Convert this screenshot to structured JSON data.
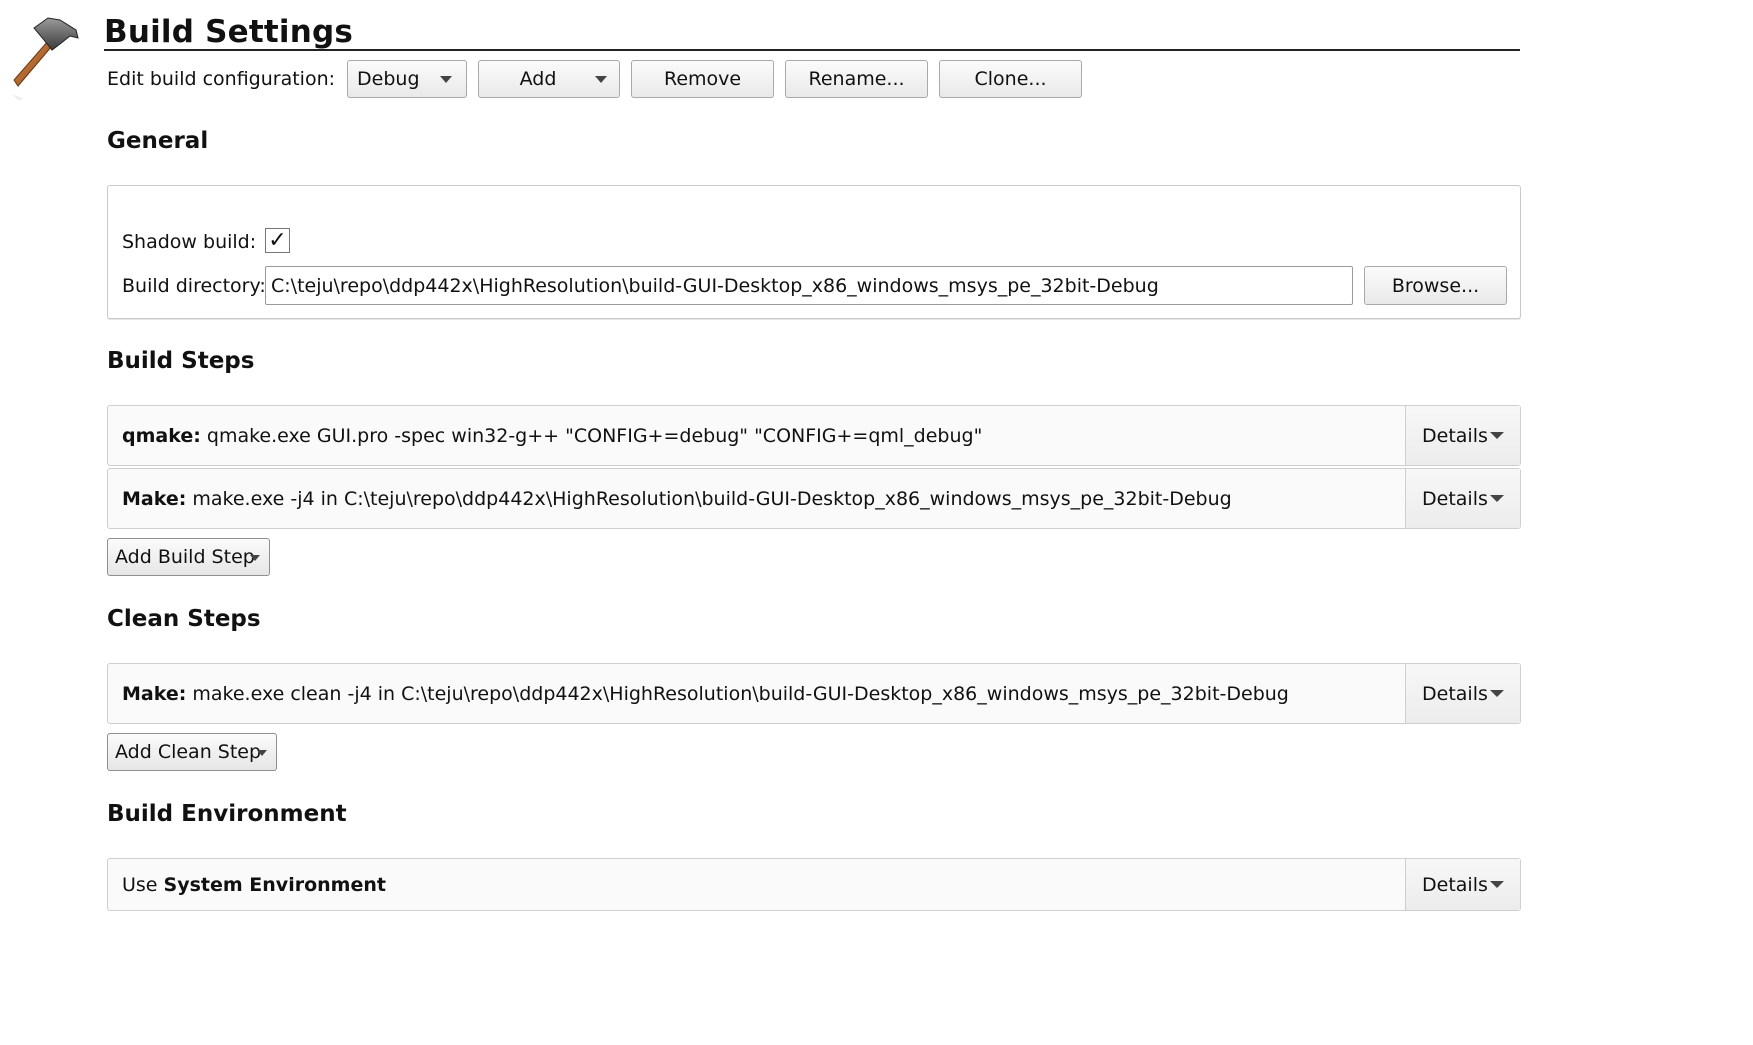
{
  "header": {
    "title": "Build Settings",
    "icon": "hammer-icon"
  },
  "config": {
    "label": "Edit build configuration:",
    "selected": "Debug",
    "add_label": "Add",
    "remove_label": "Remove",
    "rename_label": "Rename...",
    "clone_label": "Clone..."
  },
  "general": {
    "heading": "General",
    "shadow_build_label": "Shadow build:",
    "shadow_build_checked": true,
    "checkmark": "✓",
    "build_dir_label": "Build directory:",
    "build_dir_value": "C:\\teju\\repo\\ddp442x\\HighResolution\\build-GUI-Desktop_x86_windows_msys_pe_32bit-Debug",
    "browse_label": "Browse..."
  },
  "build_steps": {
    "heading": "Build Steps",
    "steps": [
      {
        "name": "qmake:",
        "command": " qmake.exe GUI.pro -spec win32-g++ \"CONFIG+=debug\" \"CONFIG+=qml_debug\"",
        "details_label": "Details"
      },
      {
        "name": "Make:",
        "command": " make.exe -j4 in C:\\teju\\repo\\ddp442x\\HighResolution\\build-GUI-Desktop_x86_windows_msys_pe_32bit-Debug",
        "details_label": "Details"
      }
    ],
    "add_label": "Add Build Step"
  },
  "clean_steps": {
    "heading": "Clean Steps",
    "steps": [
      {
        "name": "Make:",
        "command": " make.exe clean -j4 in C:\\teju\\repo\\ddp442x\\HighResolution\\build-GUI-Desktop_x86_windows_msys_pe_32bit-Debug",
        "details_label": "Details"
      }
    ],
    "add_label": "Add Clean Step"
  },
  "environment": {
    "heading": "Build Environment",
    "prefix": "Use ",
    "value": "System Environment",
    "details_label": "Details"
  }
}
